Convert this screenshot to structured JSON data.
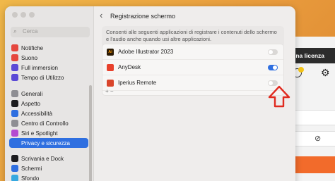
{
  "background_app": {
    "header_text": "ina licenza",
    "accent_color": "#f26b2b",
    "header_color": "#2c2c2c"
  },
  "window": {
    "title": "Registrazione schermo",
    "back_icon": "chevron-left-icon"
  },
  "sidebar": {
    "search_placeholder": "Cerca",
    "items": [
      {
        "label": "Notifiche",
        "icon": "bell-icon",
        "color": "#e5473e"
      },
      {
        "label": "Suono",
        "icon": "speaker-icon",
        "color": "#e5473e"
      },
      {
        "label": "Full immersion",
        "icon": "moon-icon",
        "color": "#5b4ad6"
      },
      {
        "label": "Tempo di Utilizzo",
        "icon": "hourglass-icon",
        "color": "#5b4ad6"
      },
      {
        "label": "Generali",
        "icon": "gear-icon",
        "color": "#8e8e93"
      },
      {
        "label": "Aspetto",
        "icon": "appearance-icon",
        "color": "#1c1c1e"
      },
      {
        "label": "Accessibilità",
        "icon": "accessibility-icon",
        "color": "#2f6fe0"
      },
      {
        "label": "Centro di Controllo",
        "icon": "control-center-icon",
        "color": "#8e8e93"
      },
      {
        "label": "Siri e Spotlight",
        "icon": "siri-icon",
        "color": "#b44bd1"
      },
      {
        "label": "Privacy e sicurezza",
        "icon": "hand-icon",
        "color": "#2f6fe0",
        "selected": true
      },
      {
        "label": "Scrivania e Dock",
        "icon": "dock-icon",
        "color": "#1c1c1e"
      },
      {
        "label": "Schermi",
        "icon": "display-icon",
        "color": "#2f6fe0"
      },
      {
        "label": "Sfondo",
        "icon": "wallpaper-icon",
        "color": "#35a8e0"
      }
    ]
  },
  "description": "Consenti alle seguenti applicazioni di registrare i contenuti dello schermo e l'audio anche quando usi altre applicazioni.",
  "apps": [
    {
      "name": "Adobe Illustrator 2023",
      "icon_text": "Ai",
      "icon_color": "#2b1a05",
      "icon_fg": "#ff9a00",
      "enabled": false
    },
    {
      "name": "AnyDesk",
      "icon_text": "",
      "icon_color": "#e8412c",
      "icon_fg": "#fff",
      "enabled": true
    },
    {
      "name": "Iperius Remote",
      "icon_text": "",
      "icon_color": "#d9452b",
      "icon_fg": "#fff",
      "enabled": false
    }
  ],
  "add_remove": "+  −",
  "annotation_color": "#e02b20"
}
